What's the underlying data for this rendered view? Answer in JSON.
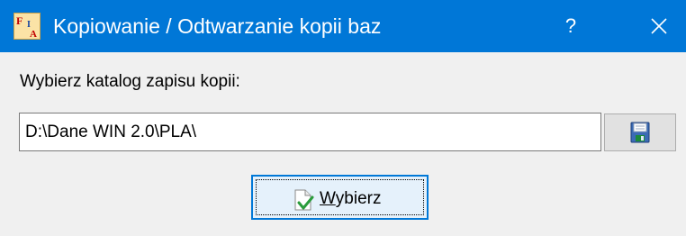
{
  "window": {
    "title": "Kopiowanie / Odtwarzanie kopii baz",
    "app_icon_letters": [
      "F",
      "I",
      "A"
    ],
    "help_label": "?",
    "close_icon": "close-icon",
    "titlebar_color": "#0077d7"
  },
  "form": {
    "prompt_label": "Wybierz katalog zapisu kopii:",
    "path_value": "D:\\Dane WIN 2.0\\PLA\\",
    "save_button_icon": "floppy-disk-icon"
  },
  "choose_button": {
    "mnemonic": "W",
    "label_rest": "ybierz",
    "icon": "document-check-icon"
  }
}
